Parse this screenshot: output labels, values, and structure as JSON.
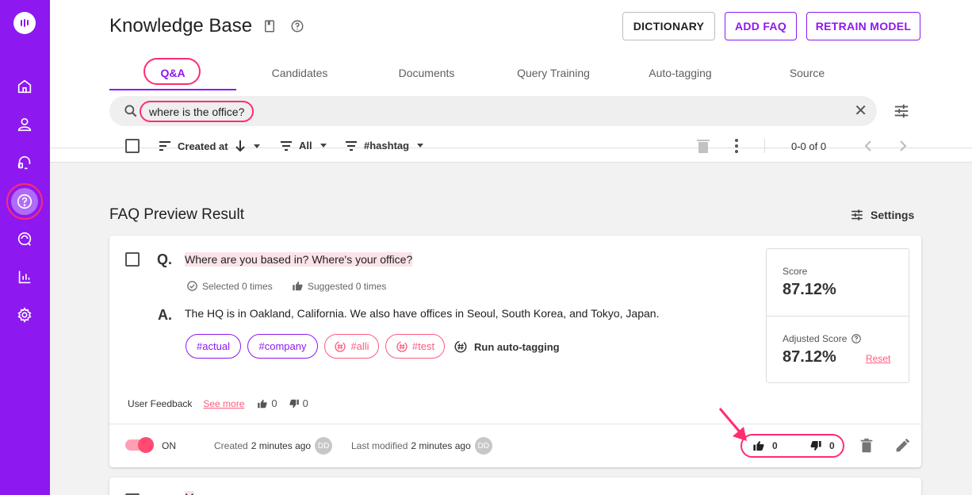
{
  "app": {
    "title": "Knowledge Base"
  },
  "header": {
    "buttons": {
      "dictionary": "DICTIONARY",
      "add_faq": "ADD FAQ",
      "retrain": "RETRAIN MODEL"
    }
  },
  "tabs": [
    "Q&A",
    "Candidates",
    "Documents",
    "Query Training",
    "Auto-tagging",
    "Source"
  ],
  "search": {
    "value": "where is the office?"
  },
  "toolbar": {
    "sort": "Created at",
    "filter": "All",
    "hashtag": "#hashtag",
    "pager": "0-0 of 0"
  },
  "preview": {
    "title": "FAQ Preview Result",
    "settings": "Settings",
    "card": {
      "q_letter": "Q.",
      "a_letter": "A.",
      "question": "Where are you based in? Where's your office?",
      "selected": "Selected 0 times",
      "suggested": "Suggested 0 times",
      "answer": "The HQ is in Oakland, California. We also have offices in Seoul, South Korea, and Tokyo, Japan.",
      "tags": [
        "#actual",
        "#company",
        "#alli",
        "#test"
      ],
      "auto_tag": "Run auto-tagging",
      "score_label": "Score",
      "score": "87.12%",
      "adjusted_label": "Adjusted Score",
      "adjusted_score": "87.12%",
      "reset": "Reset",
      "feedback_label": "User Feedback",
      "see_more": "See more",
      "feedback_up": "0",
      "feedback_down": "0",
      "toggle_label": "ON",
      "created_label": "Created",
      "created_value": "2 minutes ago",
      "modified_label": "Last modified",
      "modified_value": "2 minutes ago",
      "avatar": "DD",
      "votes_up": "0",
      "votes_down": "0"
    },
    "next_card": {
      "question_partial": "M"
    }
  },
  "colors": {
    "brand": "#8d18f0",
    "highlight": "#ff2d6f",
    "tag_red": "#ff5a7e"
  }
}
